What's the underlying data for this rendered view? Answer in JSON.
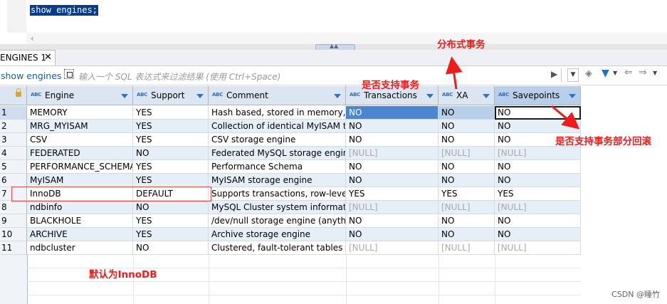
{
  "editor": {
    "code": "show engines;"
  },
  "tab": {
    "label": "ENGINES 1",
    "close": "✕"
  },
  "filter": {
    "label": "show engines",
    "placeholder": "输入一个 SQL 表达式来过滤结果 (使用 Ctrl+Space)"
  },
  "columns": [
    {
      "name": "Engine",
      "type_icon": "ABC"
    },
    {
      "name": "Support",
      "type_icon": "ABC"
    },
    {
      "name": "Comment",
      "type_icon": "ABC"
    },
    {
      "name": "Transactions",
      "type_icon": "ABC"
    },
    {
      "name": "XA",
      "type_icon": "ABC"
    },
    {
      "name": "Savepoints",
      "type_icon": "ABC"
    }
  ],
  "rows": [
    {
      "n": "1",
      "engine": "MEMORY",
      "support": "YES",
      "comment": "Hash based, stored in memory, useful",
      "transactions": "NO",
      "xa": "NO",
      "savepoints": "NO"
    },
    {
      "n": "2",
      "engine": "MRG_MYISAM",
      "support": "YES",
      "comment": "Collection of identical MyISAM tables",
      "transactions": "NO",
      "xa": "NO",
      "savepoints": "NO"
    },
    {
      "n": "3",
      "engine": "CSV",
      "support": "YES",
      "comment": "CSV storage engine",
      "transactions": "NO",
      "xa": "NO",
      "savepoints": "NO"
    },
    {
      "n": "4",
      "engine": "FEDERATED",
      "support": "NO",
      "comment": "Federated MySQL storage engine",
      "transactions": "[NULL]",
      "xa": "[NULL]",
      "savepoints": "[NULL]"
    },
    {
      "n": "5",
      "engine": "PERFORMANCE_SCHEMA",
      "support": "YES",
      "comment": "Performance Schema",
      "transactions": "NO",
      "xa": "NO",
      "savepoints": "NO"
    },
    {
      "n": "6",
      "engine": "MyISAM",
      "support": "YES",
      "comment": "MyISAM storage engine",
      "transactions": "NO",
      "xa": "NO",
      "savepoints": "NO"
    },
    {
      "n": "7",
      "engine": "InnoDB",
      "support": "DEFAULT",
      "comment": "Supports transactions, row-level locking",
      "transactions": "YES",
      "xa": "YES",
      "savepoints": "YES"
    },
    {
      "n": "8",
      "engine": "ndbinfo",
      "support": "NO",
      "comment": "MySQL Cluster system information",
      "transactions": "[NULL]",
      "xa": "[NULL]",
      "savepoints": "[NULL]"
    },
    {
      "n": "9",
      "engine": "BLACKHOLE",
      "support": "YES",
      "comment": "/dev/null storage engine (anything you",
      "transactions": "NO",
      "xa": "NO",
      "savepoints": "NO"
    },
    {
      "n": "10",
      "engine": "ARCHIVE",
      "support": "YES",
      "comment": "Archive storage engine",
      "transactions": "NO",
      "xa": "NO",
      "savepoints": "NO"
    },
    {
      "n": "11",
      "engine": "ndbcluster",
      "support": "NO",
      "comment": "Clustered, fault-tolerant tables",
      "transactions": "[NULL]",
      "xa": "[NULL]",
      "savepoints": "[NULL]"
    }
  ],
  "annotations": {
    "distributed": "分布式事务",
    "supports_tx": "是否支持事务",
    "savepoint": "是否支持事务部分回滚",
    "default": "默认为InnoDB"
  },
  "watermark": "CSDN @睡竹",
  "colors": {
    "annotation": "#ee1c1c",
    "header": "#dce6f2",
    "selected_cell": "#4d86cf"
  }
}
